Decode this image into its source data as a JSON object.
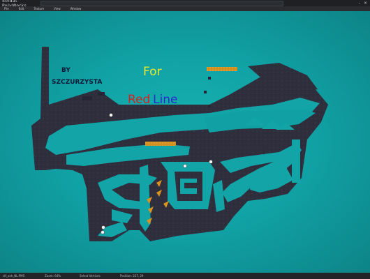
{
  "app": {
    "title": "Soldat PolyWorks"
  },
  "window_controls": {
    "minimize": "-",
    "close": "×"
  },
  "menu": [
    "File",
    "Edit",
    "Texture",
    "View",
    "Window"
  ],
  "map_text": {
    "by": "BY",
    "author": "SZCZURZYSTA",
    "for": "For",
    "red": "Red",
    "line": "Line"
  },
  "status": {
    "file": "ctf_ash_NL.PMS",
    "zoom": "Zoom: 64%",
    "tool": "Select Vertices",
    "position": "Position: 227, 29"
  },
  "colors": {
    "background": "#11a3a6",
    "rock": "#2b2b3a",
    "accent_for": "#e8e82a",
    "accent_red": "#d82020",
    "accent_line": "#2a2ac8",
    "scenery": "#d9941f"
  }
}
